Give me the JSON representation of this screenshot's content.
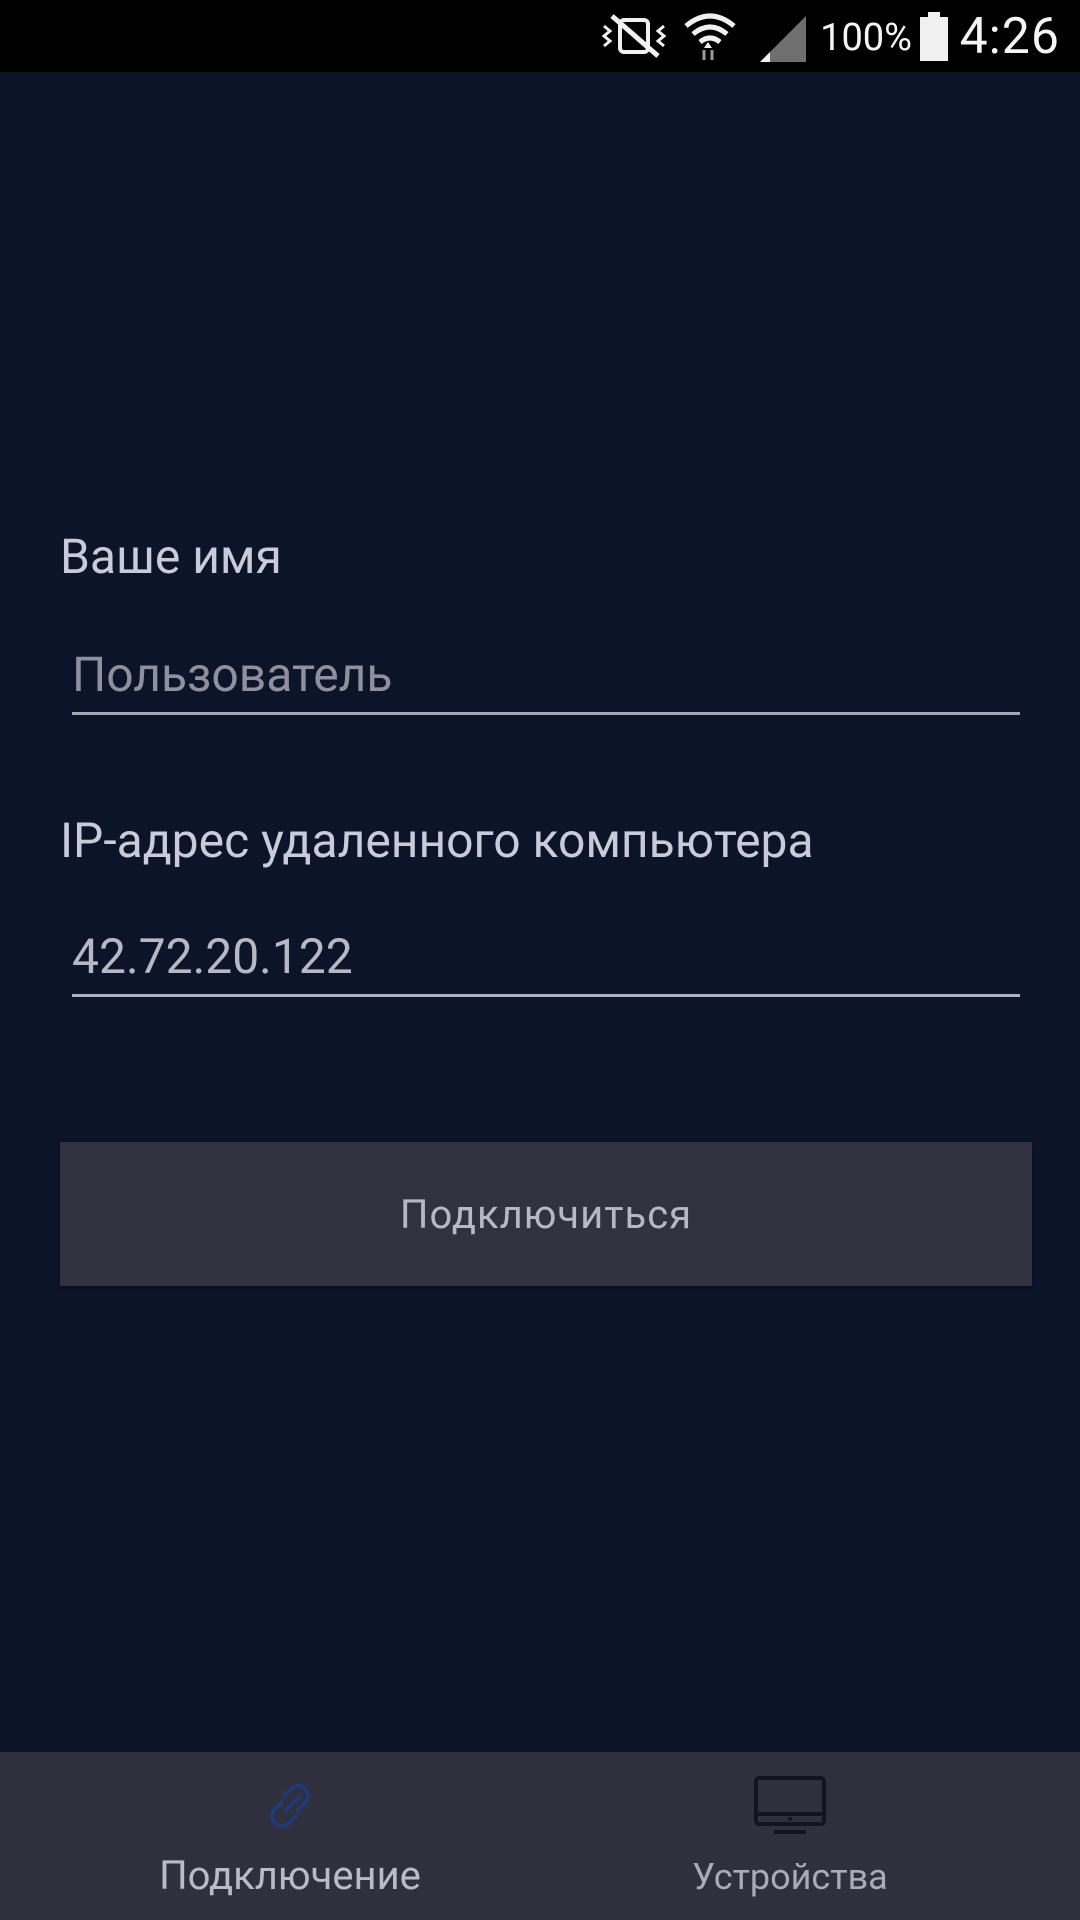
{
  "status_bar": {
    "battery_percent": "100%",
    "time": "4:26",
    "icons": [
      "vibrate-mute-icon",
      "wifi-icon",
      "signal-icon",
      "battery-icon"
    ]
  },
  "form": {
    "name_label": "Ваше имя",
    "name_placeholder": "Пользователь",
    "ip_label": "IP-адрес удаленного компьютера",
    "ip_value": "42.72.20.122",
    "connect_label": "Подключиться"
  },
  "bottom_nav": {
    "items": [
      {
        "label": "Подключение",
        "icon": "link-icon",
        "active": true
      },
      {
        "label": "Устройства",
        "icon": "monitor-icon",
        "active": false
      }
    ]
  },
  "colors": {
    "background": "#0b1428",
    "button": "#32313f",
    "nav_bar": "#302f3d",
    "active_icon": "#1f3a78"
  }
}
